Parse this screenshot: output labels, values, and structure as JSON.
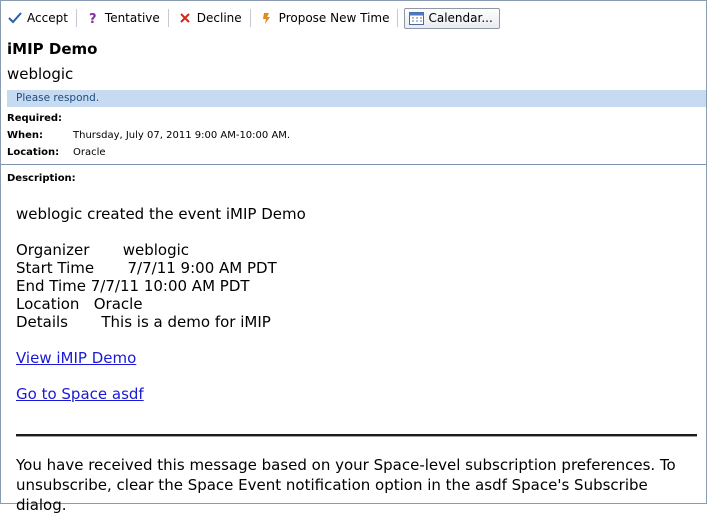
{
  "toolbar": {
    "accept": "Accept",
    "tentative": "Tentative",
    "decline": "Decline",
    "propose": "Propose New Time",
    "calendar": "Calendar...",
    "icons": {
      "accept": "checkmark-icon",
      "tentative": "question-mark-icon",
      "decline": "x-mark-icon",
      "propose": "propose-time-icon",
      "calendar": "calendar-icon"
    },
    "colors": {
      "accept": "#2a5fb0",
      "tentative": "#8a2aa8",
      "decline": "#d22a1e",
      "propose": "#e08a1a"
    }
  },
  "header": {
    "title": "iMIP Demo",
    "organizer": "weblogic",
    "respond": "Please respond."
  },
  "meta": {
    "required_label": "Required:",
    "when_label": "When:",
    "when_value": "Thursday, July 07, 2011 9:00 AM-10:00 AM.",
    "location_label": "Location:",
    "location_value": "Oracle",
    "description_label": "Description:"
  },
  "body": {
    "created": "weblogic created the event iMIP Demo",
    "organizer_k": "Organizer       ",
    "organizer_v": "weblogic",
    "start_k": "Start Time       ",
    "start_v": "7/7/11 9:00 AM PDT",
    "end_k": "End Time ",
    "end_v": "7/7/11 10:00 AM PDT",
    "location_k": "Location   ",
    "location_v": "Oracle",
    "details_k": "Details       ",
    "details_v": "This is a demo for iMIP",
    "link_view": "View iMIP Demo",
    "link_space": "Go to Space asdf",
    "footer": "You have received this message based on your Space-level subscription preferences. To unsubscribe, clear the Space Event notification option in the asdf Space's Subscribe dialog."
  }
}
